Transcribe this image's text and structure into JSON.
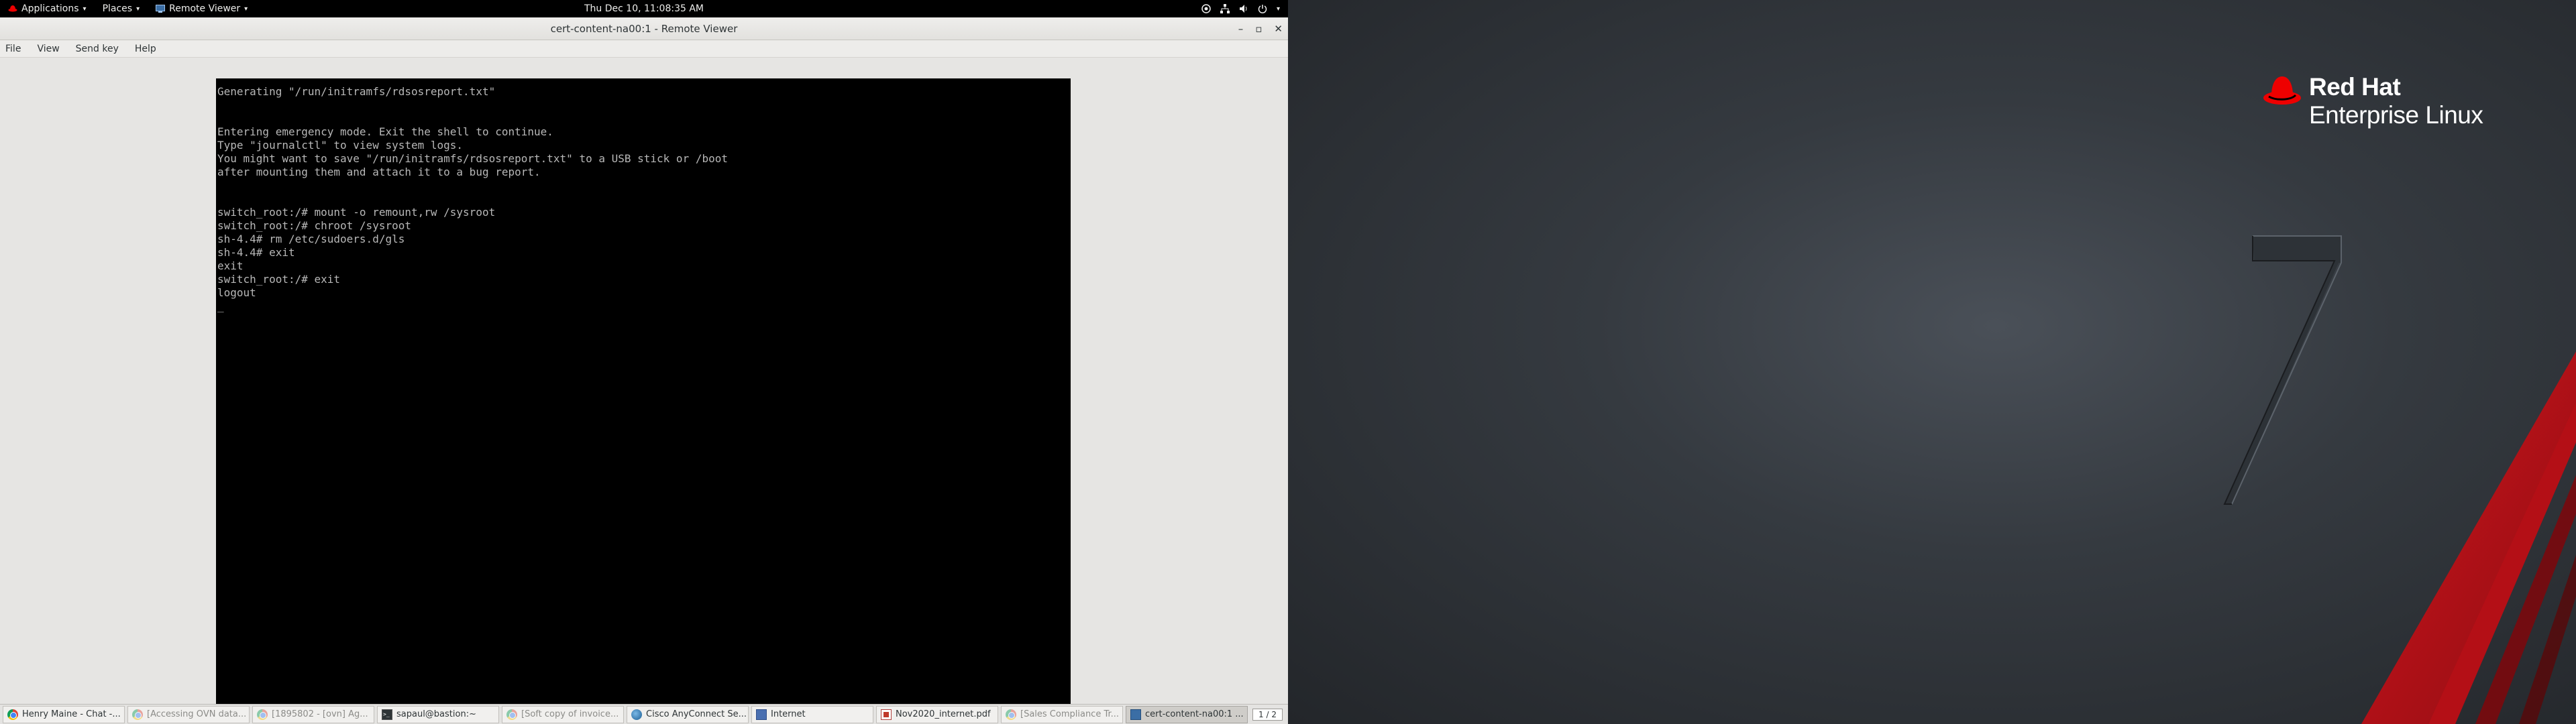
{
  "top_panel": {
    "applications_label": "Applications",
    "places_label": "Places",
    "remote_viewer_label": "Remote Viewer",
    "clock": "Thu Dec 10, 11:08:35 AM"
  },
  "window": {
    "title": "cert-content-na00:1 - Remote Viewer",
    "menu": [
      "File",
      "View",
      "Send key",
      "Help"
    ]
  },
  "console": {
    "lines": [
      "Generating \"/run/initramfs/rdsosreport.txt\"",
      "",
      "",
      "Entering emergency mode. Exit the shell to continue.",
      "Type \"journalctl\" to view system logs.",
      "You might want to save \"/run/initramfs/rdsosreport.txt\" to a USB stick or /boot",
      "after mounting them and attach it to a bug report.",
      "",
      "",
      "switch_root:/# mount -o remount,rw /sysroot",
      "switch_root:/# chroot /sysroot",
      "sh-4.4# rm /etc/sudoers.d/gls",
      "sh-4.4# exit",
      "exit",
      "switch_root:/# exit",
      "logout",
      "_"
    ]
  },
  "desktop": {
    "brand_line1": "Red Hat",
    "brand_line2": "Enterprise Linux",
    "version_numeral": "7"
  },
  "taskbar": {
    "tasks": [
      {
        "label": "Henry Maine - Chat -...",
        "icon": "chrome-icon"
      },
      {
        "label": "[Accessing OVN data...",
        "icon": "chrome-icon"
      },
      {
        "label": "[1895802 - [ovn] Ag...",
        "icon": "chrome-icon"
      },
      {
        "label": "sapaul@bastion:~",
        "icon": "terminal-icon"
      },
      {
        "label": "[Soft copy of invoice...",
        "icon": "chrome-icon"
      },
      {
        "label": "Cisco AnyConnect Se...",
        "icon": "cisco-icon"
      },
      {
        "label": "Internet",
        "icon": "document-icon"
      },
      {
        "label": "Nov2020_internet.pdf",
        "icon": "pdf-icon"
      },
      {
        "label": "[Sales Compliance Tr...",
        "icon": "chrome-icon"
      },
      {
        "label": "cert-content-na00:1 ...",
        "icon": "remote-viewer-icon"
      }
    ],
    "workspace": "1 / 2"
  }
}
